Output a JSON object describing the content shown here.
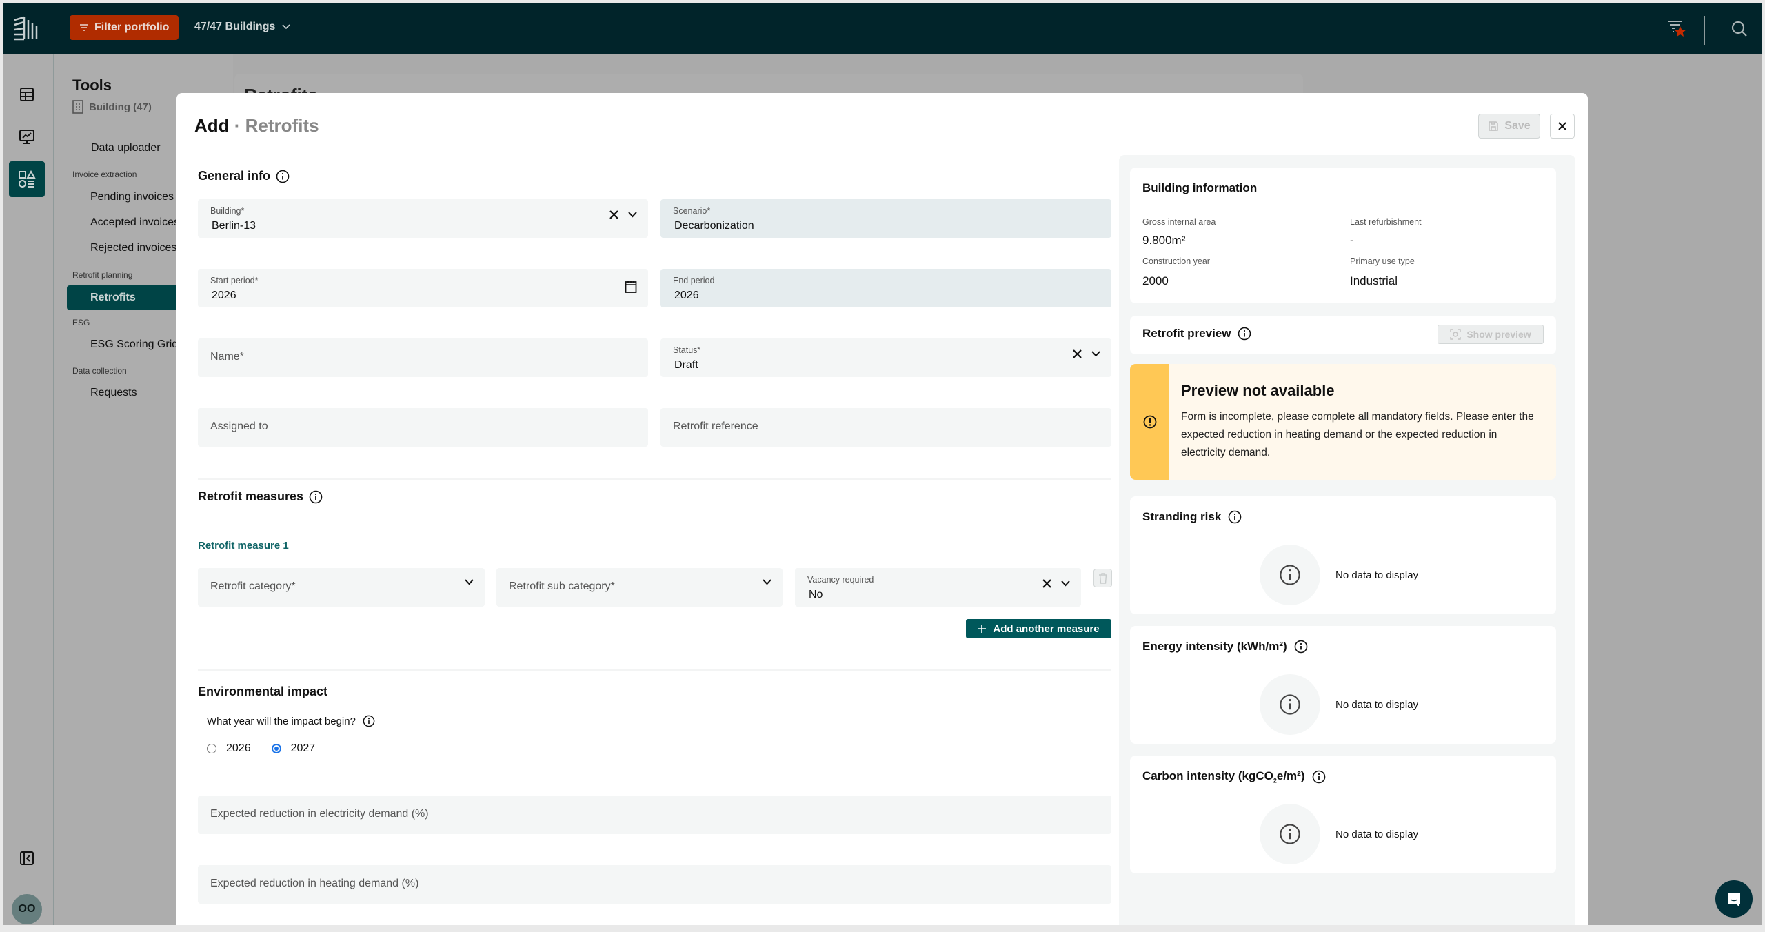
{
  "topbar": {
    "filter_label": "Filter portfolio",
    "buildings_selector": "47/47 Buildings",
    "accent_color": "#b02c00"
  },
  "rail": {
    "items": [
      {
        "icon": "table-icon",
        "active": false
      },
      {
        "icon": "dashboard-chart-icon",
        "active": false
      },
      {
        "icon": "tools-shapes-icon",
        "active": true
      }
    ],
    "collapse_icon": "collapse-sidebar-icon",
    "avatar_initials": "OO"
  },
  "tools": {
    "title": "Tools",
    "building_count": "Building (47)",
    "data_uploader": "Data uploader",
    "groups": [
      {
        "label": "Invoice extraction",
        "items": [
          "Pending invoices",
          "Accepted invoices",
          "Rejected invoices"
        ]
      },
      {
        "label": "Retrofit planning",
        "items": [
          "Retrofits"
        ]
      },
      {
        "label": "ESG",
        "items": [
          "ESG Scoring Grid"
        ]
      },
      {
        "label": "Data collection",
        "items": [
          "Requests"
        ]
      }
    ],
    "active_item": "Retrofits"
  },
  "background_page": {
    "title": "Retrofits"
  },
  "modal": {
    "title_action": "Add",
    "title_separator": " · ",
    "title_entity": "Retrofits",
    "save_label": "Save",
    "general_info": {
      "title": "General info",
      "building": {
        "label": "Building*",
        "value": "Berlin-13"
      },
      "scenario": {
        "label": "Scenario*",
        "value": "Decarbonization"
      },
      "start_period": {
        "label": "Start period*",
        "value": "2026"
      },
      "end_period": {
        "label": "End period",
        "value": "2026"
      },
      "name": {
        "placeholder": "Name*"
      },
      "status": {
        "label": "Status*",
        "value": "Draft"
      },
      "assigned_to": {
        "placeholder": "Assigned to"
      },
      "retrofit_reference": {
        "placeholder": "Retrofit reference"
      }
    },
    "retrofit_measures": {
      "title": "Retrofit measures",
      "measure_title": "Retrofit measure 1",
      "category_placeholder": "Retrofit category*",
      "sub_category_placeholder": "Retrofit sub category*",
      "vacancy": {
        "label": "Vacancy required",
        "value": "No"
      },
      "add_label": "Add another measure"
    },
    "environmental_impact": {
      "title": "Environmental impact",
      "question": "What year will the impact begin?",
      "options": [
        "2026",
        "2027"
      ],
      "selected": "2027",
      "electricity_placeholder": "Expected reduction in electricity demand (%)",
      "heating_placeholder": "Expected reduction in heating demand (%)"
    }
  },
  "right_panel": {
    "building_info": {
      "title": "Building information",
      "gross_internal_area_label": "Gross internal area",
      "gross_internal_area": "9.800m²",
      "last_refurbishment_label": "Last refurbishment",
      "last_refurbishment": "-",
      "construction_year_label": "Construction year",
      "construction_year": "2000",
      "primary_use_type_label": "Primary use type",
      "primary_use_type": "Industrial"
    },
    "retrofit_preview": {
      "title": "Retrofit preview",
      "show_preview_label": "Show preview"
    },
    "warning": {
      "title": "Preview not available",
      "body": "Form is incomplete, please complete all mandatory fields. Please enter the expected reduction in heating demand or the expected reduction in electricity demand.",
      "color": "#ffc855"
    },
    "stranding_risk": {
      "title": "Stranding risk",
      "empty": "No data to display"
    },
    "energy_intensity": {
      "title": "Energy intensity (kWh/m²)",
      "empty": "No data to display"
    },
    "carbon_intensity": {
      "title_prefix": "Carbon intensity (kgCO",
      "title_sub": "2",
      "title_suffix": "e/m²)",
      "empty": "No data to display"
    }
  }
}
